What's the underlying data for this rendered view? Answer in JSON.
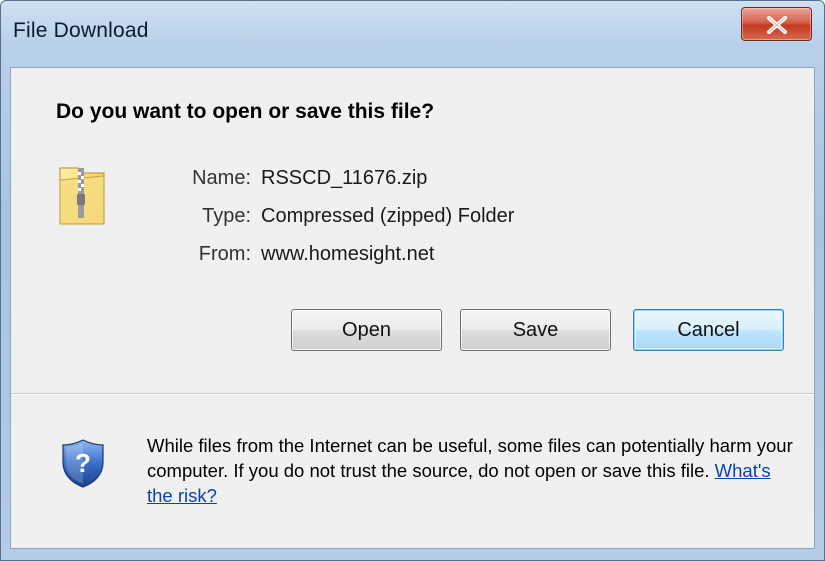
{
  "window": {
    "title": "File Download",
    "close_glyph": "X"
  },
  "dialog": {
    "question": "Do you want to open or save this file?",
    "file_icon": "zip-folder-icon",
    "info": {
      "name_label": "Name:",
      "name_value": "RSSCD_11676.zip",
      "type_label": "Type:",
      "type_value": "Compressed (zipped) Folder",
      "from_label": "From:",
      "from_value": "www.homesight.net"
    },
    "buttons": {
      "open": "Open",
      "save": "Save",
      "cancel": "Cancel"
    }
  },
  "footer": {
    "shield_icon": "security-shield-question-icon",
    "warning_text": "While files from the Internet can be useful, some files can potentially harm your computer. If you do not trust the source, do not open or save this file.",
    "risk_link": "What's the risk?"
  },
  "colors": {
    "title_bar": "#b9d0ea",
    "close_button": "#c2391f",
    "link": "#0645ad",
    "default_button_border": "#3c7fb1"
  }
}
